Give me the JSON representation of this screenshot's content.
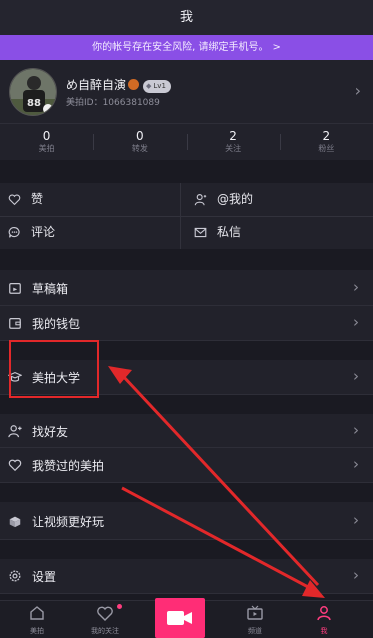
{
  "header": {
    "title": "我"
  },
  "alert": {
    "text": "你的帐号存在安全风险, 请绑定手机号。",
    "chevron": ">"
  },
  "profile": {
    "name": "め自醉自演",
    "level": "Lv1",
    "id": "美拍ID：1066381089"
  },
  "stats": [
    {
      "value": "0",
      "label": "美拍"
    },
    {
      "value": "0",
      "label": "转发"
    },
    {
      "value": "2",
      "label": "关注"
    },
    {
      "value": "2",
      "label": "粉丝"
    }
  ],
  "grid": {
    "like": "赞",
    "mention": "@我的",
    "comment": "评论",
    "message": "私信"
  },
  "menu": {
    "drafts": "草稿箱",
    "wallet": "我的钱包",
    "university": "美拍大学",
    "find_friends": "找好友",
    "liked": "我赞过的美拍",
    "better_video": "让视频更好玩",
    "settings": "设置"
  },
  "tabs": [
    {
      "label": "美拍"
    },
    {
      "label": "我的关注"
    },
    {
      "label": "频道"
    },
    {
      "label": "我"
    }
  ],
  "colors": {
    "background": "#1a1a22",
    "row": "#22222b",
    "alert": "#8a4fe6",
    "accent": "#ff2d76",
    "annotation": "#e2282a"
  },
  "icons": {
    "like": "heart-icon",
    "mention": "person-icon",
    "comment": "chat-bubble-icon",
    "message": "mail-icon",
    "drafts": "drafts-box-icon",
    "wallet": "wallet-icon",
    "university": "graduation-cap-icon",
    "find_friends": "add-person-icon",
    "liked": "heart-icon",
    "better_video": "gift-box-icon",
    "settings": "gear-icon"
  }
}
